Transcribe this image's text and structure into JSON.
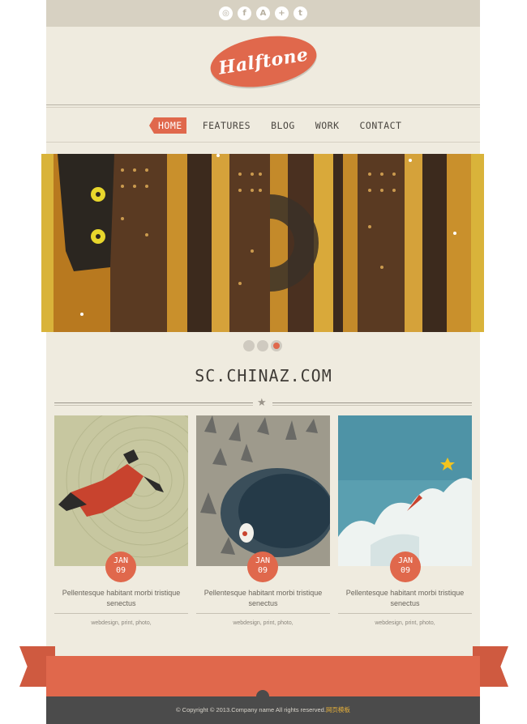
{
  "social": {
    "icons": [
      {
        "name": "instagram-icon",
        "glyph": "◎"
      },
      {
        "name": "facebook-icon",
        "glyph": "f"
      },
      {
        "name": "appstore-icon",
        "glyph": "A"
      },
      {
        "name": "googleplus-icon",
        "glyph": "+"
      },
      {
        "name": "twitter-icon",
        "glyph": "t"
      }
    ]
  },
  "logo": {
    "text": "Halftone"
  },
  "nav": {
    "items": [
      {
        "label": "HOME",
        "active": true
      },
      {
        "label": "FEATURES",
        "active": false
      },
      {
        "label": "BLOG",
        "active": false
      },
      {
        "label": "WORK",
        "active": false
      },
      {
        "label": "CONTACT",
        "active": false
      }
    ]
  },
  "slider": {
    "active_index": 2,
    "count": 3
  },
  "heading": {
    "title": "SC.CHINAZ.COM"
  },
  "cards": [
    {
      "month": "JAN",
      "day": "09",
      "title": "Pellentesque habitant morbi tristique senectus",
      "tags": "webdesign, print, photo,"
    },
    {
      "month": "JAN",
      "day": "09",
      "title": "Pellentesque habitant morbi tristique senectus",
      "tags": "webdesign, print, photo,"
    },
    {
      "month": "JAN",
      "day": "09",
      "title": "Pellentesque habitant morbi tristique senectus",
      "tags": "webdesign, print, photo,"
    }
  ],
  "footer": {
    "copyright": "© Copyright © 2013.Company name All rights reserved.",
    "link": "网页模板"
  },
  "colors": {
    "accent": "#e0684c",
    "page_bg": "#efebdf",
    "topbar_bg": "#d7d1c2",
    "footer_bg": "#4b4b4b"
  }
}
